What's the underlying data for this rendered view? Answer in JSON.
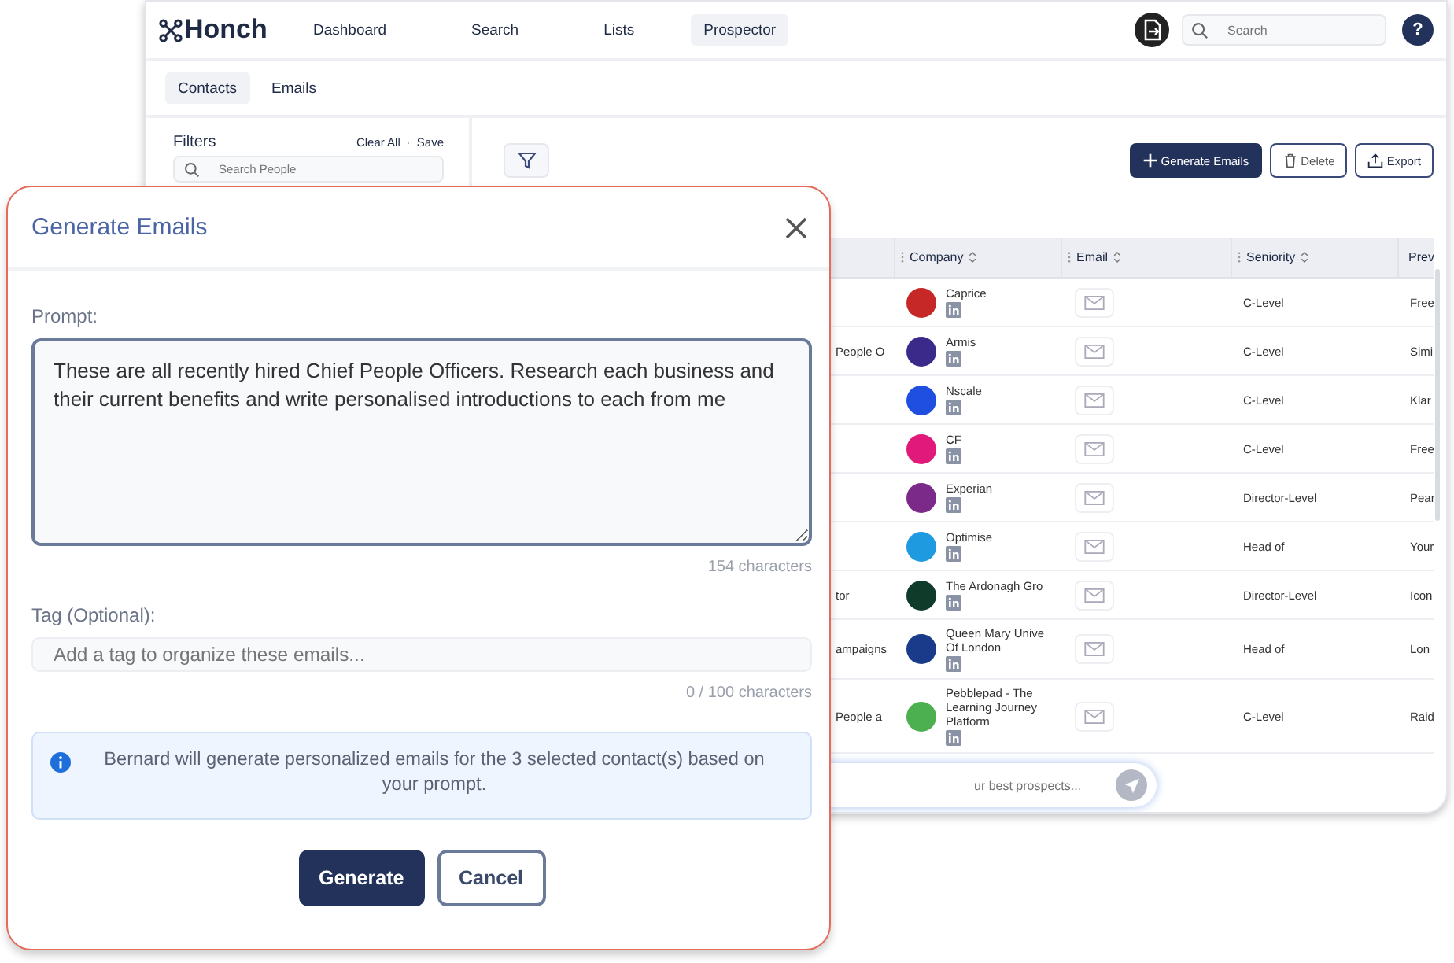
{
  "nav": {
    "logo": "Honch",
    "items": [
      {
        "label": "Dashboard",
        "selected": false
      },
      {
        "label": "Search",
        "selected": false
      },
      {
        "label": "Lists",
        "selected": false
      },
      {
        "label": "Prospector",
        "selected": true
      }
    ],
    "search": {
      "placeholder": "Search"
    },
    "help": "?"
  },
  "subtabs": [
    {
      "label": "Contacts",
      "selected": true
    },
    {
      "label": "Emails",
      "selected": false
    }
  ],
  "filters": {
    "title": "Filters",
    "clear": "Clear All",
    "separator": "·",
    "save": "Save",
    "search": {
      "placeholder": "Search People"
    }
  },
  "toolbar": [
    {
      "kind": "primary",
      "label": "Generate Emails"
    },
    {
      "kind": "delete",
      "label": "Delete"
    },
    {
      "kind": "export",
      "label": "Export"
    }
  ],
  "table": {
    "columns": [
      {
        "label": "Company",
        "sortable": true
      },
      {
        "label": "Email",
        "sortable": true
      },
      {
        "label": "Seniority",
        "sortable": true
      },
      {
        "label": "Prev",
        "sortable": false
      }
    ],
    "rows": [
      {
        "column_1": "",
        "company": "Caprice",
        "color": "#c62828",
        "seniority": "C-Level",
        "column_5": "Free"
      },
      {
        "column_1": "People O",
        "company": "Armis",
        "color": "#3b2a8a",
        "seniority": "C-Level",
        "column_5": "Simi"
      },
      {
        "column_1": "",
        "company": "Nscale",
        "color": "#1e4fe0",
        "seniority": "C-Level",
        "column_5": "Klar"
      },
      {
        "column_1": "",
        "company": "CF",
        "color": "#e0197b",
        "seniority": "C-Level",
        "column_5": "Free"
      },
      {
        "column_1": "",
        "company": "Experian",
        "color": "#7b2a8a",
        "seniority": "Director-Level",
        "column_5": "Pear"
      },
      {
        "column_1": "",
        "company": "Optimise",
        "color": "#1e9be0",
        "seniority": "Head of",
        "column_5": "Your"
      },
      {
        "column_1": "tor",
        "company": "The Ardonagh Gro",
        "color": "#0f3b2a",
        "seniority": "Director-Level",
        "column_5": "Icon"
      },
      {
        "column_1": "ampaigns",
        "company": "Queen Mary Unive\nOf London",
        "color": "#1a3a8a",
        "seniority": "Head of",
        "column_5": "Lon"
      },
      {
        "column_1": "People a",
        "company": "Pebblepad - The\nLearning Journey\nPlatform",
        "color": "#4caf50",
        "seniority": "C-Level",
        "column_5": "Raid"
      }
    ]
  },
  "chat": {
    "placeholder": "ur best prospects..."
  },
  "modal": {
    "title": "Generate Emails",
    "prompt": {
      "label": "Prompt:",
      "value": "These are all recently hired Chief People Officers. Research each business and their current benefits and write personalised introductions to each from me",
      "counter": "154 characters"
    },
    "tag": {
      "label": "Tag (Optional):",
      "placeholder": "Add a tag to organize these emails...",
      "counter": "0 / 100 characters"
    },
    "info": "Bernard will generate personalized emails for the 3 selected contact(s) based on your prompt.",
    "buttons": [
      {
        "kind": "primary",
        "label": "Generate"
      },
      {
        "kind": "secondary",
        "label": "Cancel"
      }
    ]
  }
}
